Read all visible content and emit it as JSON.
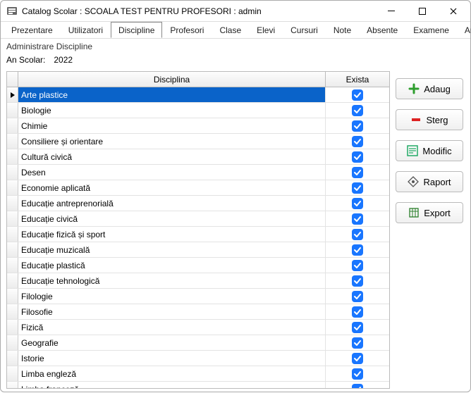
{
  "window": {
    "title": "Catalog Scolar : SCOALA TEST PENTRU PROFESORI : admin"
  },
  "menu": {
    "items": [
      {
        "label": "Prezentare",
        "active": false
      },
      {
        "label": "Utilizatori",
        "active": false
      },
      {
        "label": "Discipline",
        "active": true
      },
      {
        "label": "Profesori",
        "active": false
      },
      {
        "label": "Clase",
        "active": false
      },
      {
        "label": "Elevi",
        "active": false
      },
      {
        "label": "Cursuri",
        "active": false
      },
      {
        "label": "Note",
        "active": false
      },
      {
        "label": "Absente",
        "active": false
      },
      {
        "label": "Examene",
        "active": false
      },
      {
        "label": "Audit",
        "active": false
      }
    ]
  },
  "page": {
    "title": "Administrare Discipline",
    "year_label": "An Scolar:",
    "year_value": "2022"
  },
  "grid": {
    "headers": {
      "name": "Disciplina",
      "exists": "Exista"
    },
    "rows": [
      {
        "name": "Arte plastice",
        "exists": true,
        "selected": true
      },
      {
        "name": "Biologie",
        "exists": true
      },
      {
        "name": "Chimie",
        "exists": true
      },
      {
        "name": "Consiliere și orientare",
        "exists": true
      },
      {
        "name": "Cultură civică",
        "exists": true
      },
      {
        "name": "Desen",
        "exists": true
      },
      {
        "name": "Economie aplicată",
        "exists": true
      },
      {
        "name": "Educație antreprenorială",
        "exists": true
      },
      {
        "name": "Educație civică",
        "exists": true
      },
      {
        "name": "Educație fizică și sport",
        "exists": true
      },
      {
        "name": "Educație muzicală",
        "exists": true
      },
      {
        "name": "Educație plastică",
        "exists": true
      },
      {
        "name": "Educație tehnologică",
        "exists": true
      },
      {
        "name": "Filologie",
        "exists": true
      },
      {
        "name": "Filosofie",
        "exists": true
      },
      {
        "name": "Fizică",
        "exists": true
      },
      {
        "name": "Geografie",
        "exists": true
      },
      {
        "name": "Istorie",
        "exists": true
      },
      {
        "name": "Limba engleză",
        "exists": true
      },
      {
        "name": "Limba franceză",
        "exists": true
      }
    ]
  },
  "buttons": {
    "add": "Adaug",
    "delete": "Sterg",
    "modify": "Modific",
    "report": "Raport",
    "export": "Export"
  }
}
